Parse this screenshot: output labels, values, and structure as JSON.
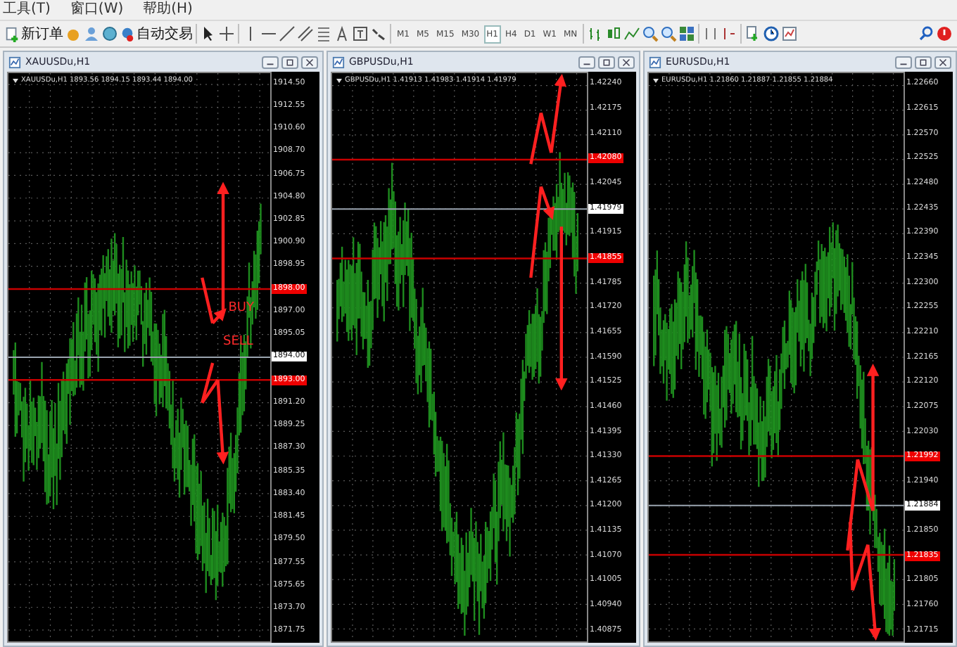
{
  "menu": [
    {
      "label": "工具(T)"
    },
    {
      "label": "窗口(W)"
    },
    {
      "label": "帮助(H)"
    }
  ],
  "toolbar": {
    "new_order": "新订单",
    "auto_trading": "自动交易",
    "timeframes": [
      {
        "label": "M1",
        "selected": false
      },
      {
        "label": "M5",
        "selected": false
      },
      {
        "label": "M15",
        "selected": false
      },
      {
        "label": "M30",
        "selected": false
      },
      {
        "label": "H1",
        "selected": true
      },
      {
        "label": "H4",
        "selected": false
      },
      {
        "label": "D1",
        "selected": false
      },
      {
        "label": "W1",
        "selected": false
      },
      {
        "label": "MN",
        "selected": false
      }
    ]
  },
  "charts": [
    {
      "title": "XAUUSDu,H1",
      "info": "XAUUSDu,H1 1893.56 1894.15 1893.44 1894.00",
      "notes": [
        {
          "text": "BUY"
        },
        {
          "text": "SELL"
        }
      ],
      "axis": [
        {
          "text": "1914.50",
          "kind": "tick"
        },
        {
          "text": "1912.55",
          "kind": "tick"
        },
        {
          "text": "1910.60",
          "kind": "tick"
        },
        {
          "text": "1908.70",
          "kind": "tick"
        },
        {
          "text": "1906.75",
          "kind": "tick"
        },
        {
          "text": "1904.80",
          "kind": "tick"
        },
        {
          "text": "1902.85",
          "kind": "tick"
        },
        {
          "text": "1900.90",
          "kind": "tick"
        },
        {
          "text": "1898.95",
          "kind": "tick"
        },
        {
          "text": "1898.00",
          "kind": "line"
        },
        {
          "text": "1897.00",
          "kind": "tick"
        },
        {
          "text": "1895.05",
          "kind": "tick"
        },
        {
          "text": "1894.00",
          "kind": "bid"
        },
        {
          "text": "1893.00",
          "kind": "line"
        },
        {
          "text": "1891.20",
          "kind": "tick"
        },
        {
          "text": "1889.25",
          "kind": "tick"
        },
        {
          "text": "1887.30",
          "kind": "tick"
        },
        {
          "text": "1885.35",
          "kind": "tick"
        },
        {
          "text": "1883.40",
          "kind": "tick"
        },
        {
          "text": "1881.45",
          "kind": "tick"
        },
        {
          "text": "1879.50",
          "kind": "tick"
        },
        {
          "text": "1877.55",
          "kind": "tick"
        },
        {
          "text": "1875.65",
          "kind": "tick"
        },
        {
          "text": "1873.70",
          "kind": "tick"
        },
        {
          "text": "1871.75",
          "kind": "tick"
        }
      ]
    },
    {
      "title": "GBPUSDu,H1",
      "info": "GBPUSDu,H1 1.41913 1.41983 1.41914 1.41979",
      "axis": [
        {
          "text": "1.42240",
          "kind": "tick"
        },
        {
          "text": "1.42175",
          "kind": "tick"
        },
        {
          "text": "1.42110",
          "kind": "tick"
        },
        {
          "text": "1.42080",
          "kind": "line"
        },
        {
          "text": "1.42045",
          "kind": "tick"
        },
        {
          "text": "1.41979",
          "kind": "bid"
        },
        {
          "text": "1.41915",
          "kind": "tick"
        },
        {
          "text": "1.41855",
          "kind": "line"
        },
        {
          "text": "1.41785",
          "kind": "tick"
        },
        {
          "text": "1.41720",
          "kind": "tick"
        },
        {
          "text": "1.41655",
          "kind": "tick"
        },
        {
          "text": "1.41590",
          "kind": "tick"
        },
        {
          "text": "1.41525",
          "kind": "tick"
        },
        {
          "text": "1.41460",
          "kind": "tick"
        },
        {
          "text": "1.41395",
          "kind": "tick"
        },
        {
          "text": "1.41330",
          "kind": "tick"
        },
        {
          "text": "1.41265",
          "kind": "tick"
        },
        {
          "text": "1.41200",
          "kind": "tick"
        },
        {
          "text": "1.41135",
          "kind": "tick"
        },
        {
          "text": "1.41070",
          "kind": "tick"
        },
        {
          "text": "1.41005",
          "kind": "tick"
        },
        {
          "text": "1.40940",
          "kind": "tick"
        },
        {
          "text": "1.40875",
          "kind": "tick"
        }
      ]
    },
    {
      "title": "EURUSDu,H1",
      "info": "EURUSDu,H1 1.21860 1.21887 1.21855 1.21884",
      "axis": [
        {
          "text": "1.22660",
          "kind": "tick"
        },
        {
          "text": "1.22615",
          "kind": "tick"
        },
        {
          "text": "1.22570",
          "kind": "tick"
        },
        {
          "text": "1.22525",
          "kind": "tick"
        },
        {
          "text": "1.22480",
          "kind": "tick"
        },
        {
          "text": "1.22435",
          "kind": "tick"
        },
        {
          "text": "1.22390",
          "kind": "tick"
        },
        {
          "text": "1.22345",
          "kind": "tick"
        },
        {
          "text": "1.22300",
          "kind": "tick"
        },
        {
          "text": "1.22255",
          "kind": "tick"
        },
        {
          "text": "1.22210",
          "kind": "tick"
        },
        {
          "text": "1.22165",
          "kind": "tick"
        },
        {
          "text": "1.22120",
          "kind": "tick"
        },
        {
          "text": "1.22075",
          "kind": "tick"
        },
        {
          "text": "1.22030",
          "kind": "tick"
        },
        {
          "text": "1.21992",
          "kind": "line"
        },
        {
          "text": "1.21940",
          "kind": "tick"
        },
        {
          "text": "1.21884",
          "kind": "bid"
        },
        {
          "text": "1.21850",
          "kind": "tick"
        },
        {
          "text": "1.21835",
          "kind": "line"
        },
        {
          "text": "1.21805",
          "kind": "tick"
        },
        {
          "text": "1.21760",
          "kind": "tick"
        },
        {
          "text": "1.21715",
          "kind": "tick"
        }
      ]
    }
  ]
}
